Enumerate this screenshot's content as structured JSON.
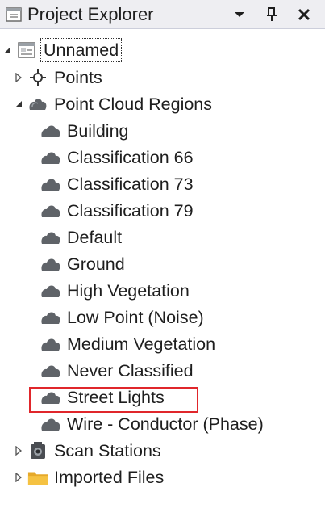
{
  "panel": {
    "title": "Project Explorer",
    "icons": {
      "title": "project-explorer-icon",
      "dropdown": "chevron-down-icon",
      "pin": "pin-icon",
      "close": "close-icon"
    }
  },
  "tree": {
    "root": {
      "label": "Unnamed",
      "expanded": true
    },
    "points": {
      "label": "Points",
      "expanded": false
    },
    "regions": {
      "label": "Point Cloud Regions",
      "expanded": true,
      "items": [
        "Building",
        "Classification 66",
        "Classification 73",
        "Classification 79",
        "Default",
        "Ground",
        "High Vegetation",
        "Low Point (Noise)",
        "Medium Vegetation",
        "Never Classified",
        "Street Lights",
        "Wire - Conductor (Phase)"
      ]
    },
    "scan_stations": {
      "label": "Scan Stations",
      "expanded": false
    },
    "imported_files": {
      "label": "Imported Files",
      "expanded": false
    }
  },
  "highlighted_item": "Street Lights",
  "colors": {
    "highlight_border": "#e0262b",
    "folder": "#f5c242",
    "region_icon": "#5f6368"
  }
}
